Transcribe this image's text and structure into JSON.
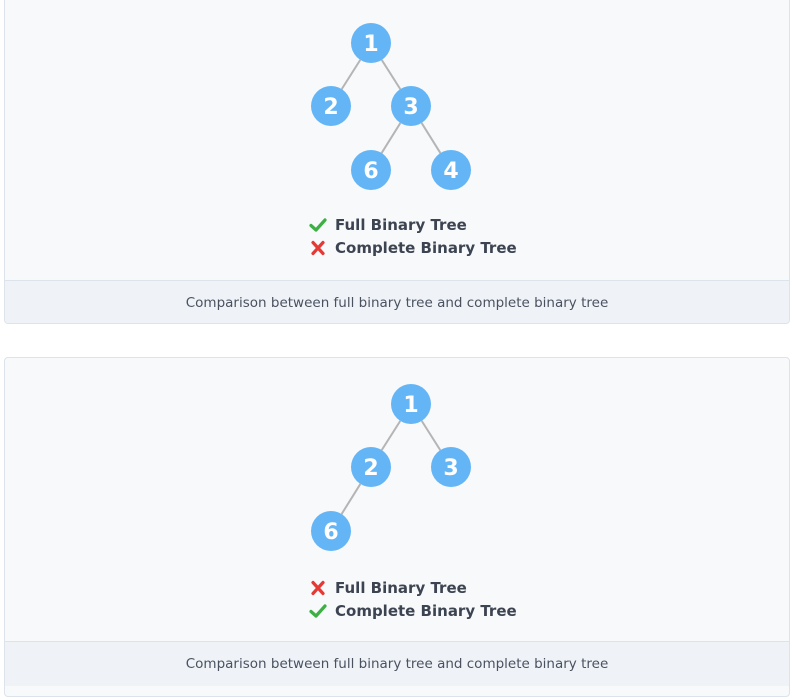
{
  "figures": [
    {
      "nodes": [
        {
          "id": "a",
          "label": "1"
        },
        {
          "id": "b",
          "label": "2"
        },
        {
          "id": "c",
          "label": "3"
        },
        {
          "id": "d",
          "label": "6"
        },
        {
          "id": "e",
          "label": "4"
        }
      ],
      "edges": [
        [
          "a",
          "b"
        ],
        [
          "a",
          "c"
        ],
        [
          "c",
          "d"
        ],
        [
          "c",
          "e"
        ]
      ],
      "checks": [
        {
          "status": "yes",
          "label": "Full Binary Tree"
        },
        {
          "status": "no",
          "label": "Complete Binary Tree"
        }
      ],
      "caption": "Comparison between full binary tree and complete binary tree"
    },
    {
      "nodes": [
        {
          "id": "a",
          "label": "1"
        },
        {
          "id": "b",
          "label": "2"
        },
        {
          "id": "c",
          "label": "3"
        },
        {
          "id": "d",
          "label": "6"
        }
      ],
      "edges": [
        [
          "a",
          "b"
        ],
        [
          "a",
          "c"
        ],
        [
          "b",
          "d"
        ]
      ],
      "checks": [
        {
          "status": "no",
          "label": "Full Binary Tree"
        },
        {
          "status": "yes",
          "label": "Complete Binary Tree"
        }
      ],
      "caption": "Comparison between full binary tree and complete binary tree"
    }
  ],
  "colors": {
    "node_fill": "#64b5f6",
    "edge": "#b5b5b5",
    "check": "#3cb043",
    "cross": "#e53935"
  }
}
